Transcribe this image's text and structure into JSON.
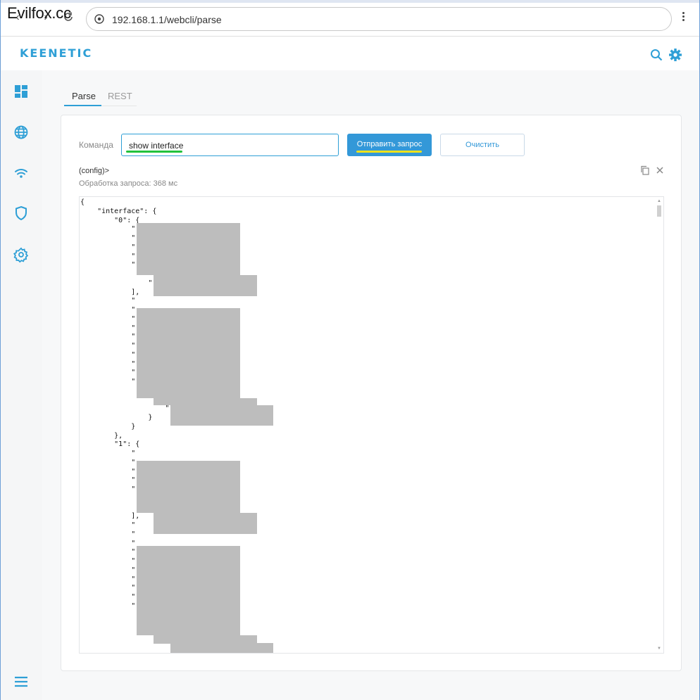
{
  "browser": {
    "watermark": "Evilfox.cc",
    "url": "192.168.1.1/webcli/parse"
  },
  "app": {
    "logo": "KEENETIC"
  },
  "sidebar": {
    "items": [
      "dashboard-icon",
      "globe-icon",
      "wifi-icon",
      "shield-icon",
      "gear-icon"
    ],
    "bottom": "menu-icon"
  },
  "tabs": [
    {
      "label": "Parse",
      "active": true
    },
    {
      "label": "REST",
      "active": false
    }
  ],
  "form": {
    "command_label": "Команда",
    "command_value": "show interface",
    "send_label": "Отправить запрос",
    "clear_label": "Очистить"
  },
  "result": {
    "prompt": "(config)>",
    "timing": "Обработка запроса: 368 мс"
  },
  "code": {
    "lines": [
      "{",
      "    \"interface\": {",
      "        \"0\": {",
      "            \"",
      "            \"",
      "            \"",
      "            \"",
      "            \"",
      "                \"",
      "                \"",
      "            ],",
      "            \"",
      "            \"",
      "            \"",
      "            \"",
      "            \"",
      "            \"",
      "            \"",
      "            \"",
      "            \"",
      "            \"",
      "                \"",
      "                    \"",
      "                    \"",
      "                }",
      "            }",
      "        },",
      "        \"1\": {",
      "            \"",
      "            \"",
      "            \"",
      "            \"",
      "            \"",
      "                \"",
      "                \"",
      "            ],",
      "            \"",
      "            \"",
      "            \"",
      "            \"",
      "            \"",
      "            \"",
      "            \"",
      "            \"",
      "            \"",
      "            \"",
      "                \"",
      "                    \""
    ]
  },
  "colors": {
    "accent": "#2e9fd6",
    "button": "#3398d8",
    "highlight_green": "#22c23b",
    "highlight_yellow": "#f1e21a",
    "redaction": "#bdbdbd"
  }
}
